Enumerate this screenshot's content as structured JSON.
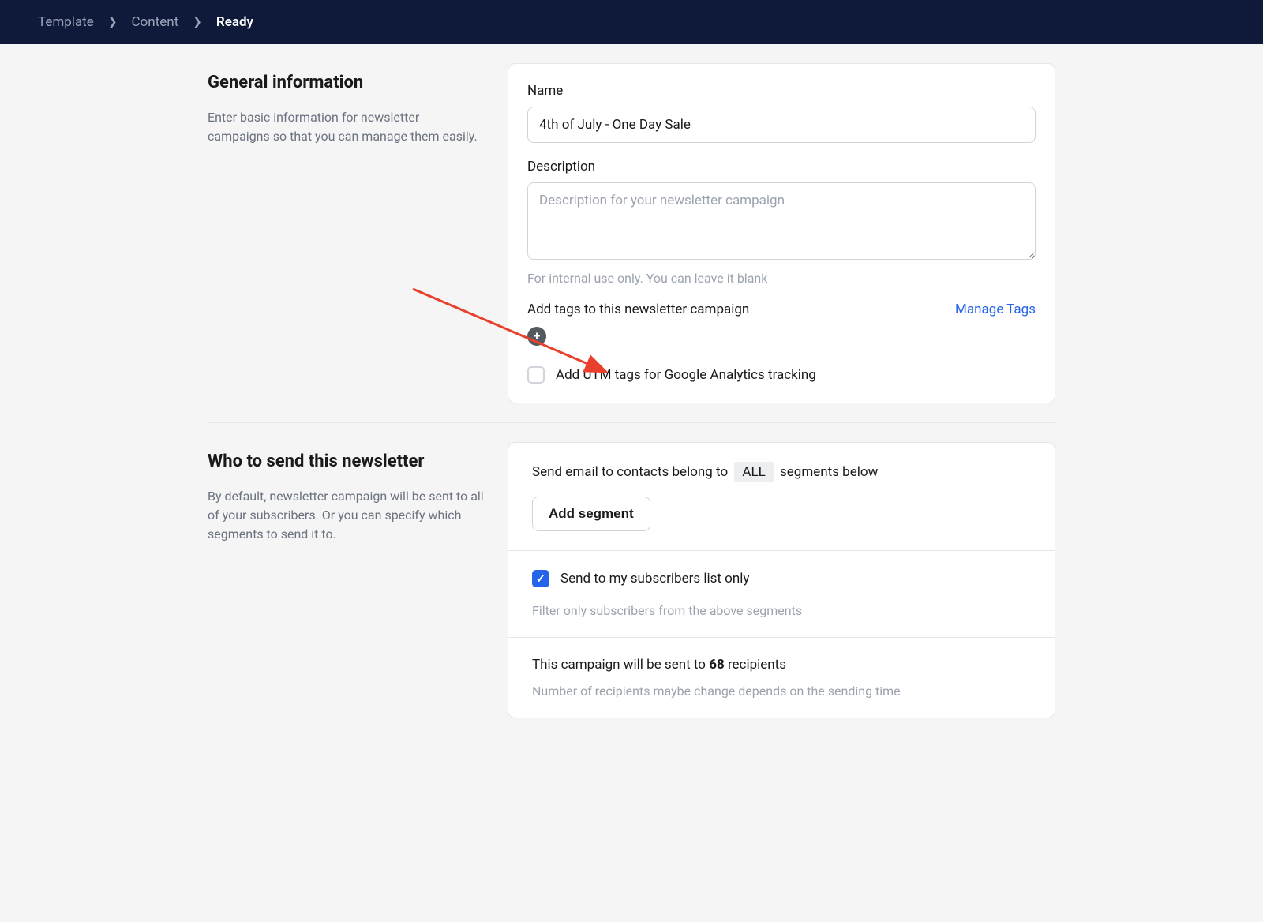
{
  "breadcrumb": {
    "items": [
      {
        "label": "Template",
        "active": false
      },
      {
        "label": "Content",
        "active": false
      },
      {
        "label": "Ready",
        "active": true
      }
    ]
  },
  "sections": {
    "general": {
      "title": "General information",
      "description": "Enter basic information for newsletter campaigns so that you can manage them easily.",
      "name_label": "Name",
      "name_value": "4th of July - One Day Sale",
      "desc_label": "Description",
      "desc_placeholder": "Description for your newsletter campaign",
      "desc_help": "For internal use only. You can leave it blank",
      "tags_label": "Add tags to this newsletter campaign",
      "manage_tags_link": "Manage Tags",
      "utm_checkbox_label": "Add UTM tags for Google Analytics tracking"
    },
    "recipients": {
      "title": "Who to send this newsletter",
      "description": "By default, newsletter campaign will be sent to all of your subscribers. Or you can specify which segments to send it to.",
      "segment_text_before": "Send email to contacts belong to",
      "segment_badge": "ALL",
      "segment_text_after": "segments below",
      "add_segment_button": "Add segment",
      "subscribers_checkbox_label": "Send to my subscribers list only",
      "subscribers_help": "Filter only subscribers from the above segments",
      "summary_before": "This campaign will be sent to",
      "summary_count": "68",
      "summary_after": "recipients",
      "summary_help": "Number of recipients maybe change depends on the sending time"
    }
  }
}
